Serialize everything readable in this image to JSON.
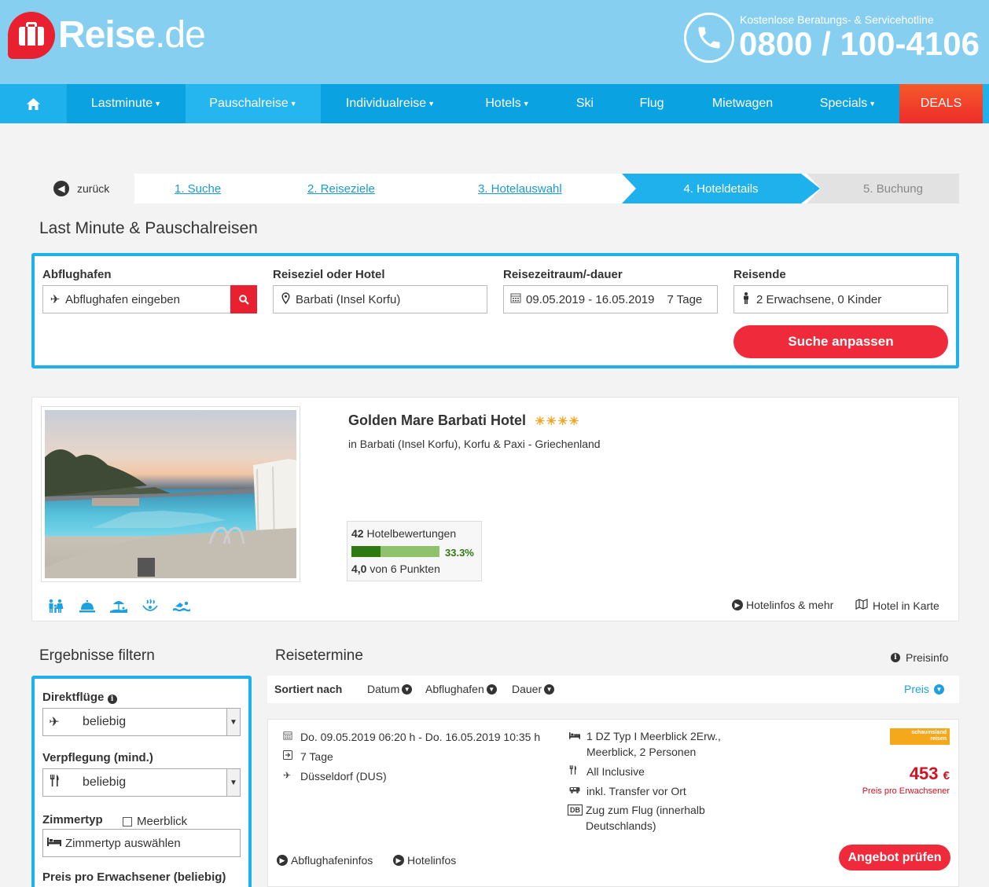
{
  "header": {
    "logo_text_bold": "Reise",
    "logo_text_light": ".de",
    "hotline_label": "Kostenlose Beratungs- & Servicehotline",
    "hotline_number": "0800 / 100-4106"
  },
  "nav": {
    "items": [
      {
        "label": "Lastminute",
        "dropdown": true
      },
      {
        "label": "Pauschalreise",
        "dropdown": true
      },
      {
        "label": "Individualreise",
        "dropdown": true
      },
      {
        "label": "Hotels",
        "dropdown": true
      },
      {
        "label": "Ski",
        "dropdown": false
      },
      {
        "label": "Flug",
        "dropdown": false
      },
      {
        "label": "Mietwagen",
        "dropdown": false
      },
      {
        "label": "Specials",
        "dropdown": true
      },
      {
        "label": "DEALS",
        "dropdown": false
      }
    ]
  },
  "steps": {
    "back": "zurück",
    "s1": "1. Suche",
    "s2": "2. Reiseziele",
    "s3": "3. Hotelauswahl",
    "s4": "4. Hoteldetails",
    "s5": "5. Buchung"
  },
  "page_title": "Last Minute & Pauschalreisen",
  "search": {
    "departure_label": "Abflughafen",
    "departure_placeholder": "Abflughafen eingeben",
    "destination_label": "Reiseziel oder Hotel",
    "destination_value": "Barbati (Insel Korfu)",
    "period_label": "Reisezeitraum/-dauer",
    "period_dates": "09.05.2019 - 16.05.2019",
    "period_duration": "7 Tage",
    "travelers_label": "Reisende",
    "travelers_value": "2 Erwachsene, 0 Kinder",
    "submit": "Suche anpassen"
  },
  "hotel": {
    "name": "Golden Mare Barbati Hotel",
    "stars": 4,
    "location": "in Barbati (Insel Korfu), Korfu & Paxi - Griechenland",
    "reviews_count": "42",
    "reviews_label": "Hotelbewertungen",
    "recommend_percent": "33.3%",
    "recommend_fraction": 0.333,
    "score": "4,0",
    "score_suffix": "von 6 Punkten",
    "link_info": "Hotelinfos & mehr",
    "link_map": "Hotel in Karte",
    "amenities": [
      "family-icon",
      "service-bell-icon",
      "beach-icon",
      "spa-icon",
      "swimming-icon"
    ]
  },
  "filter": {
    "heading": "Ergebnisse filtern",
    "direct_label": "Direktflüge",
    "direct_value": "beliebig",
    "board_label": "Verpflegung (mind.)",
    "board_value": "beliebig",
    "room_label": "Zimmertyp",
    "seaview_label": "Meerblick",
    "room_placeholder": "Zimmertyp auswählen",
    "price_label": "Preis pro Erwachsener (beliebig)"
  },
  "results": {
    "heading": "Reisetermine",
    "price_info": "Preisinfo",
    "sorted_by": "Sortiert nach",
    "sort_date": "Datum",
    "sort_airport": "Abflughafen",
    "sort_duration": "Dauer",
    "sort_price": "Preis"
  },
  "offer": {
    "dates": "Do. 09.05.2019 06:20 h - Do. 16.05.2019 10:35 h",
    "duration": "7 Tage",
    "airport": "Düsseldorf (DUS)",
    "room_line1": "1 DZ Typ I Meerblick 2Erw.,",
    "room_line2": "Meerblick, 2 Personen",
    "board": "All Inclusive",
    "transfer": "inkl. Transfer vor Ort",
    "train_line1": "Zug zum Flug (innerhalb",
    "train_line2": "Deutschlands)",
    "train_badge": "DB",
    "operator_line1": "schauinsland",
    "operator_line2": "reisen",
    "price": "453",
    "currency": "€",
    "price_note": "Preis pro Erwachsener",
    "link_airport": "Abflughafeninfos",
    "link_hotel": "Hotelinfos",
    "cta": "Angebot prüfen"
  }
}
